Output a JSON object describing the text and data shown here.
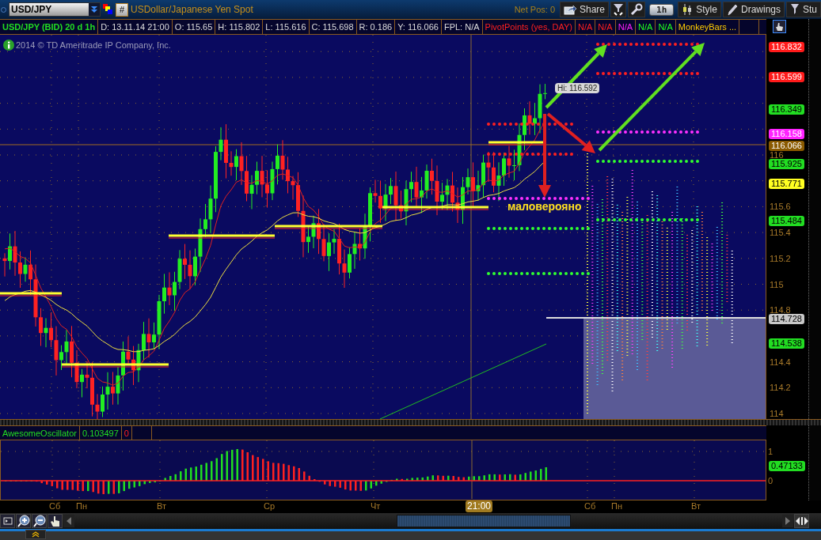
{
  "toolbar": {
    "symbol": "USD/JPY",
    "link_button": "#",
    "description": "USDollar/Japanese Yen Spot",
    "net_position": "Net Pos: 0",
    "buttons": [
      {
        "kind": "share",
        "label": "Share"
      },
      {
        "kind": "expand"
      },
      {
        "kind": "settings"
      },
      {
        "kind": "aggregation",
        "label": "1h"
      },
      {
        "kind": "style",
        "label": "Style"
      },
      {
        "kind": "drawings",
        "label": "Drawings"
      },
      {
        "kind": "studies",
        "label": "Stu"
      }
    ]
  },
  "info_bar": {
    "title": "USD/JPY (BID) 20 d 1h",
    "fields": [
      "D: 13.11.14 21:00",
      "O: 115.65",
      "H: 115.802",
      "L: 115.616",
      "C: 115.698",
      "R: 0.186",
      "Y: 116.066",
      "FPL: N/A"
    ],
    "studies": [
      {
        "label": "PivotPoints (yes, DAY)",
        "color": "#ff2020"
      },
      {
        "label": "N/A",
        "color": "#ff2020"
      },
      {
        "label": "N/A",
        "color": "#ff2020"
      },
      {
        "label": "N/A",
        "color": "#ff20ff"
      },
      {
        "label": "N/A",
        "color": "#20ff20"
      },
      {
        "label": "N/A",
        "color": "#20ff20"
      },
      {
        "label": "MonkeyBars ...",
        "color": "#ffcc00"
      }
    ]
  },
  "chart": {
    "copyright": "2014 © TD Ameritrade IP Company, Inc.",
    "high_label": "Hi: 116.592",
    "annotation": "маловерояно",
    "price_ticks": [
      "116",
      "115.6",
      "115.4",
      "115.2",
      "115",
      "114.8",
      "114.4",
      "114.2",
      "114"
    ],
    "price_badges": [
      {
        "value": "116.832",
        "color": "#ff1a1a"
      },
      {
        "value": "116.599",
        "color": "#ff1a1a"
      },
      {
        "value": "116.349",
        "color": "#22dd22"
      },
      {
        "value": "116.158",
        "color": "#ff22ff"
      },
      {
        "value": "116.066",
        "color": "#8a5a00"
      },
      {
        "value": "115.925",
        "color": "#22dd22"
      },
      {
        "value": "115.771",
        "color": "#ffff22"
      },
      {
        "value": "115.484",
        "color": "#22dd22"
      },
      {
        "value": "114.728",
        "color": "#c8c8c8"
      },
      {
        "value": "114.538",
        "color": "#22dd22"
      }
    ]
  },
  "oscillator": {
    "name": "AwesomeOscillator",
    "value": "0.103497",
    "signal": "0",
    "ticks": [
      "1",
      "0"
    ],
    "badge": "0.47133"
  },
  "time_axis": [
    {
      "label": "Сб",
      "kind": "day"
    },
    {
      "label": "Пн",
      "kind": "day"
    },
    {
      "label": "Вт",
      "kind": "day"
    },
    {
      "label": "Ср",
      "kind": "day"
    },
    {
      "label": "Чт",
      "kind": "day"
    },
    {
      "label": "21:00",
      "kind": "cursor"
    },
    {
      "label": "Сб",
      "kind": "day"
    },
    {
      "label": "Пн",
      "kind": "day"
    },
    {
      "label": "Вт",
      "kind": "day"
    }
  ]
}
